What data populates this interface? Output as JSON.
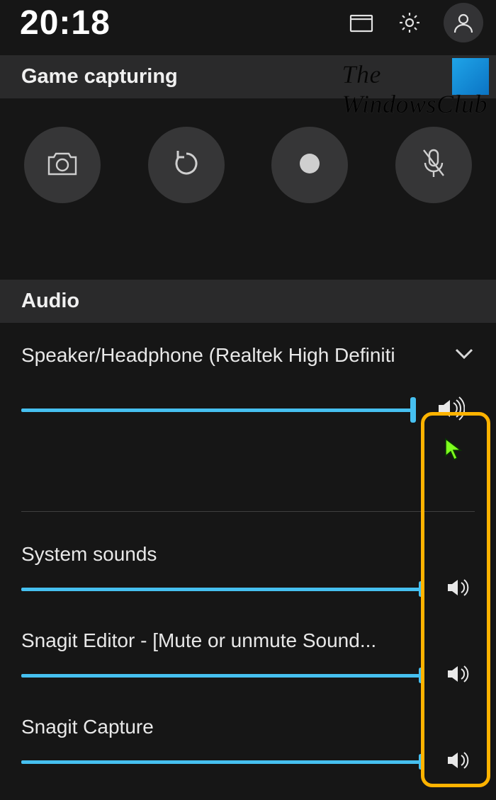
{
  "header": {
    "clock": "20:18"
  },
  "watermark": {
    "line1": "The",
    "line2": "WindowsClub"
  },
  "sections": {
    "capture_title": "Game capturing",
    "audio_title": "Audio"
  },
  "audio": {
    "device_label": "Speaker/Headphone (Realtek High Definiti",
    "device_volume_percent": 92,
    "items": [
      {
        "label": "System sounds",
        "volume_percent": 100
      },
      {
        "label": "Snagit Editor - [Mute or unmute Sound...",
        "volume_percent": 100
      },
      {
        "label": "Snagit Capture",
        "volume_percent": 100
      }
    ]
  },
  "icons": {
    "folder": "folder-icon",
    "settings": "gear-icon",
    "profile": "person-icon",
    "camera": "camera-icon",
    "replay": "replay-icon",
    "record": "record-icon",
    "mic_off": "mic-off-icon",
    "chevron": "chevron-down-icon",
    "volume": "volume-icon"
  },
  "colors": {
    "accent": "#46c0f0",
    "highlight": "#ffb300",
    "cursor": "#7eff1e"
  }
}
